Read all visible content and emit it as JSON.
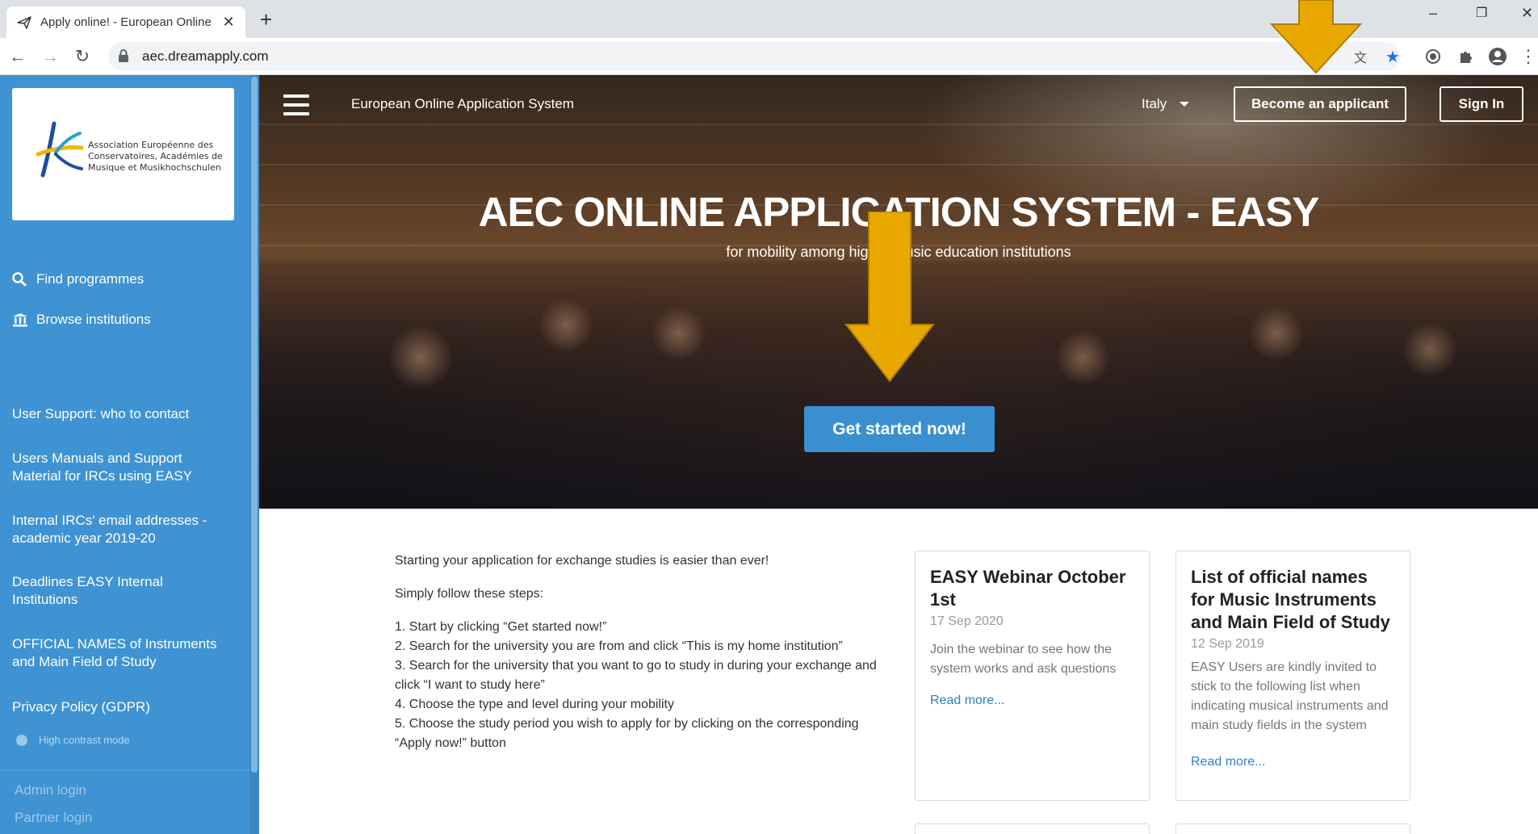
{
  "browser": {
    "tab_title": "Apply online! - European Online",
    "url": "aec.dreamapply.com"
  },
  "sidebar": {
    "logo_lines": [
      "Association Européenne des",
      "Conservatoires, Académies de",
      "Musique et Musikhochschulen"
    ],
    "nav": [
      "Find programmes",
      "Browse institutions"
    ],
    "links": [
      "User Support: who to contact",
      "Users Manuals and Support Material for IRCs using EASY",
      "Internal IRCs' email addresses - academic year 2019-20",
      "Deadlines EASY Internal Institutions",
      "OFFICIAL NAMES of Instruments and Main Field of Study",
      "Privacy Policy (GDPR)"
    ],
    "high_contrast": "High contrast mode",
    "admin_login": "Admin login",
    "partner_login": "Partner login"
  },
  "header": {
    "site_name": "European Online Application System",
    "language": "Italy",
    "become_applicant": "Become an applicant",
    "sign_in": "Sign In"
  },
  "hero": {
    "title": "AEC ONLINE APPLICATION SYSTEM - EASY",
    "subtitle": "for mobility among higher music education institutions",
    "cta": "Get started now!"
  },
  "intro": {
    "lead": "Starting your application for exchange studies is easier than ever!",
    "steps_heading": "Simply follow these steps:",
    "steps": [
      "1. Start by clicking “Get started now!”",
      "2. Search for the university you are from and click “This is my home institution”",
      "3. Search for the university that you want to go to study in during your exchange and click “I want to study here”",
      "4. Choose the type and level during your mobility",
      "5. Choose the study period you wish to apply for by clicking on the corresponding “Apply now!” button"
    ]
  },
  "news": [
    {
      "title": "EASY Webinar October 1st",
      "date": "17 Sep 2020",
      "body": "Join the webinar to see how the system works and ask questions",
      "more": "Read more..."
    },
    {
      "title": "List of official names for Music Instruments and Main Field of Study",
      "date": "12 Sep 2019",
      "body": "EASY Users are kindly invited to stick to the following list when indicating musical instruments and main study fields in the system",
      "more": "Read more..."
    }
  ],
  "colors": {
    "sidebar": "#3f93d2",
    "cta": "#3a8fd0",
    "annotation_arrow": "#e8a800",
    "link": "#2f7fc4"
  }
}
